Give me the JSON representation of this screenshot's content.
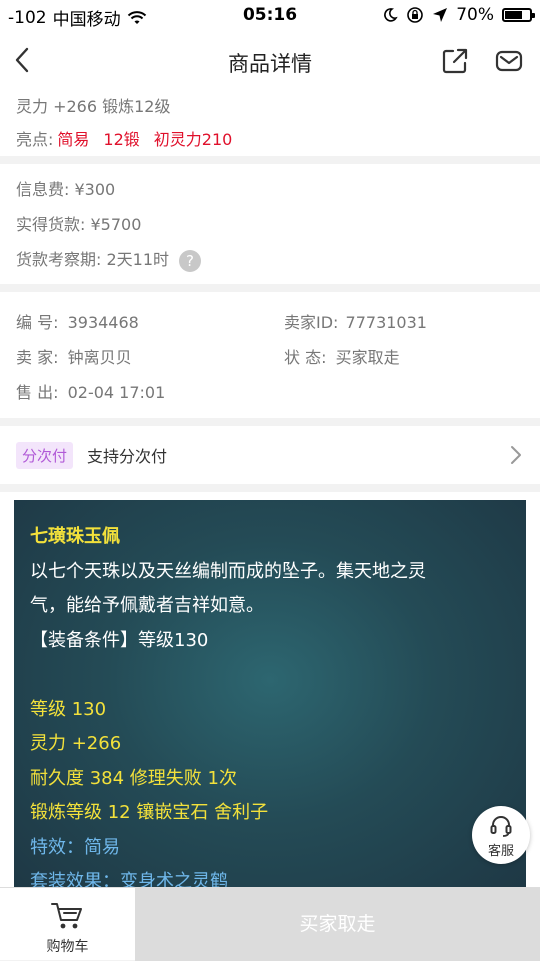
{
  "status_bar": {
    "signal": "-102",
    "carrier": "中国移动",
    "time": "05:16",
    "battery_percent": "70%",
    "battery_level": 0.7
  },
  "nav": {
    "title": "商品详情",
    "icons": [
      "back-arrow-icon",
      "share-icon",
      "mail-icon"
    ]
  },
  "summary": {
    "attr_line": "灵力 +266 锻炼12级",
    "highlights_label": "亮点:",
    "highlights": [
      "简易",
      "12锻",
      "初灵力210"
    ]
  },
  "fees": {
    "info_fee": "信息费: ¥300",
    "actual_payment": "实得货款: ¥5700",
    "review_period": "货款考察期: 2天11时",
    "help_icon": "?"
  },
  "order": {
    "id_label": "编 号:",
    "id_value": "3934468",
    "seller_id_label": "卖家ID:",
    "seller_id_value": "77731031",
    "seller_label": "卖 家:",
    "seller_value": "钟离贝贝",
    "status_label": "状 态:",
    "status_value": "买家取走",
    "sold_label": "售 出:",
    "sold_value": "02-04 17:01"
  },
  "installment": {
    "tag": "分次付",
    "text": "支持分次付"
  },
  "item": {
    "name": "七璜珠玉佩",
    "desc_line1": "以七个天珠以及天丝编制而成的坠子。集天地之灵",
    "desc_line2": "气，能给予佩戴者吉祥如意。",
    "requirement": "【装备条件】等级130",
    "level": "等级 130",
    "spirit": "灵力 +266",
    "durability": "耐久度 384 修理失败 1次",
    "forge": "锻炼等级 12 镶嵌宝石 舍利子",
    "effect": "特效：简易",
    "set_effect": "套装效果：变身术之灵鹤"
  },
  "service": {
    "label": "客服"
  },
  "bottom": {
    "cart_label": "购物车",
    "buy_label": "买家取走"
  },
  "colors": {
    "highlight_red": "#e0102b",
    "item_yellow": "#f3e13b",
    "item_blue": "#6fb7ea",
    "tag_purple": "#b15ad7"
  }
}
